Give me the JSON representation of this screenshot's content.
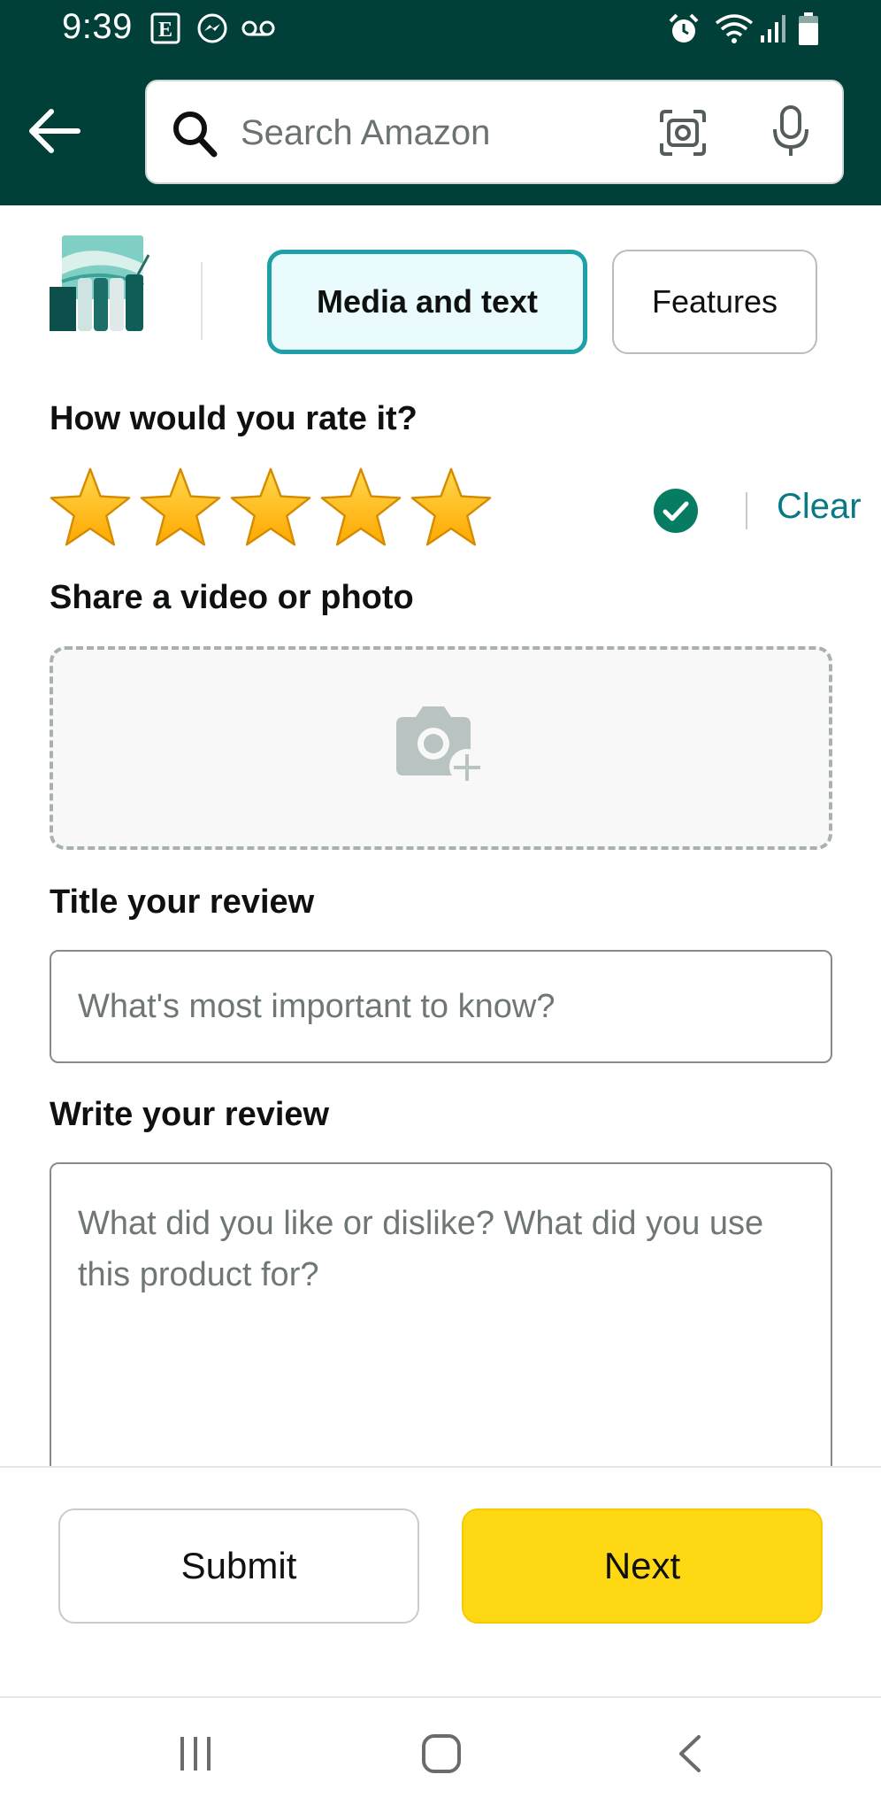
{
  "status_bar": {
    "time": "9:39",
    "icons": [
      "etsy-icon",
      "messenger-icon",
      "voicemail-icon",
      "alarm-icon",
      "wifi-icon",
      "signal-icon",
      "battery-icon"
    ]
  },
  "header": {
    "back_icon": "arrow-left-icon",
    "search_placeholder": "Search Amazon",
    "lens_icon": "camera-lens-icon",
    "mic_icon": "microphone-icon"
  },
  "tabs": [
    {
      "label": "Media and text",
      "selected": true
    },
    {
      "label": "Features",
      "selected": false
    }
  ],
  "rating": {
    "heading": "How would you rate it?",
    "stars": 5,
    "max_stars": 5,
    "clear_label": "Clear"
  },
  "media": {
    "heading": "Share a video or photo",
    "icon": "add-photo-icon"
  },
  "title_field": {
    "heading": "Title your review",
    "placeholder": "What's most important to know?"
  },
  "review_field": {
    "heading": "Write your review",
    "placeholder": "What did you like or dislike? What did you use this product for?"
  },
  "actions": {
    "submit_label": "Submit",
    "next_label": "Next"
  },
  "colors": {
    "header_bg": "#004038",
    "accent_teal": "#1ea0aa",
    "link": "#077a86",
    "next_button": "#ffd814",
    "star": "#ffb400"
  },
  "nav_bar": {
    "icons": [
      "recent-apps-icon",
      "home-icon",
      "back-icon"
    ]
  }
}
